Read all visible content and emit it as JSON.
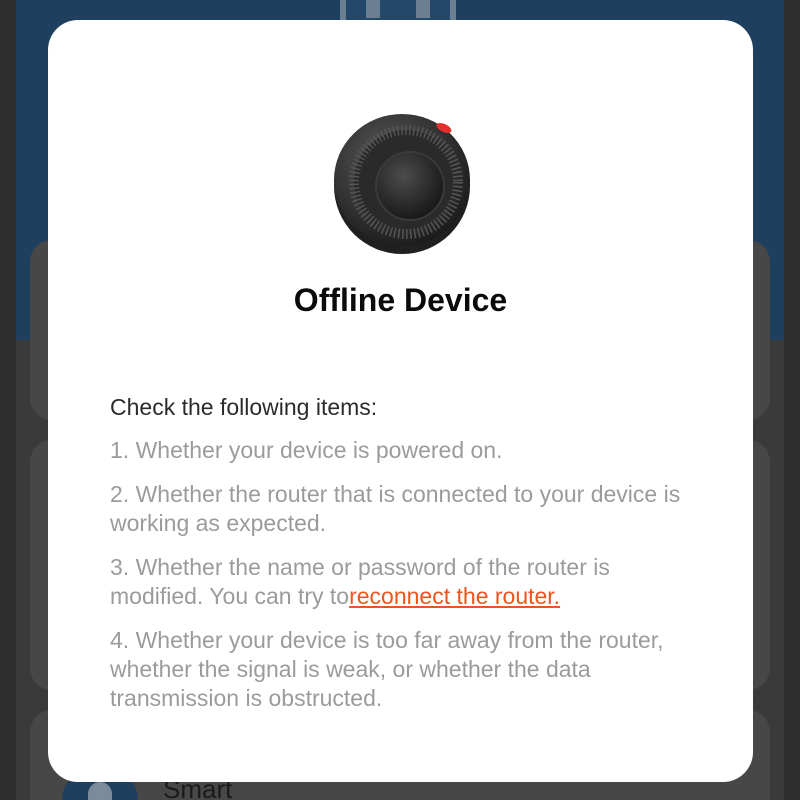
{
  "background": {
    "partial_label": "Smart"
  },
  "modal": {
    "device_image_icon": "smart-speaker-device",
    "title": "Offline Device",
    "check_heading": "Check the following items:",
    "items": [
      {
        "text": "1. Whether your device is powered on."
      },
      {
        "text": "2. Whether the router that is connected to your device is working as expected."
      },
      {
        "text": "3. Whether the name or password of the router is modified. You can try to",
        "link": "reconnect the router."
      },
      {
        "text": "4. Whether your device is too far away from the router, whether the signal is weak, or whether the data transmission is obstructed."
      }
    ]
  },
  "colors": {
    "link": "#f0541e",
    "title": "#0b0b0b",
    "muted_text": "#9b9b9b",
    "overlay": "#3a3a3a",
    "header_blue": "#1f3f5e"
  }
}
